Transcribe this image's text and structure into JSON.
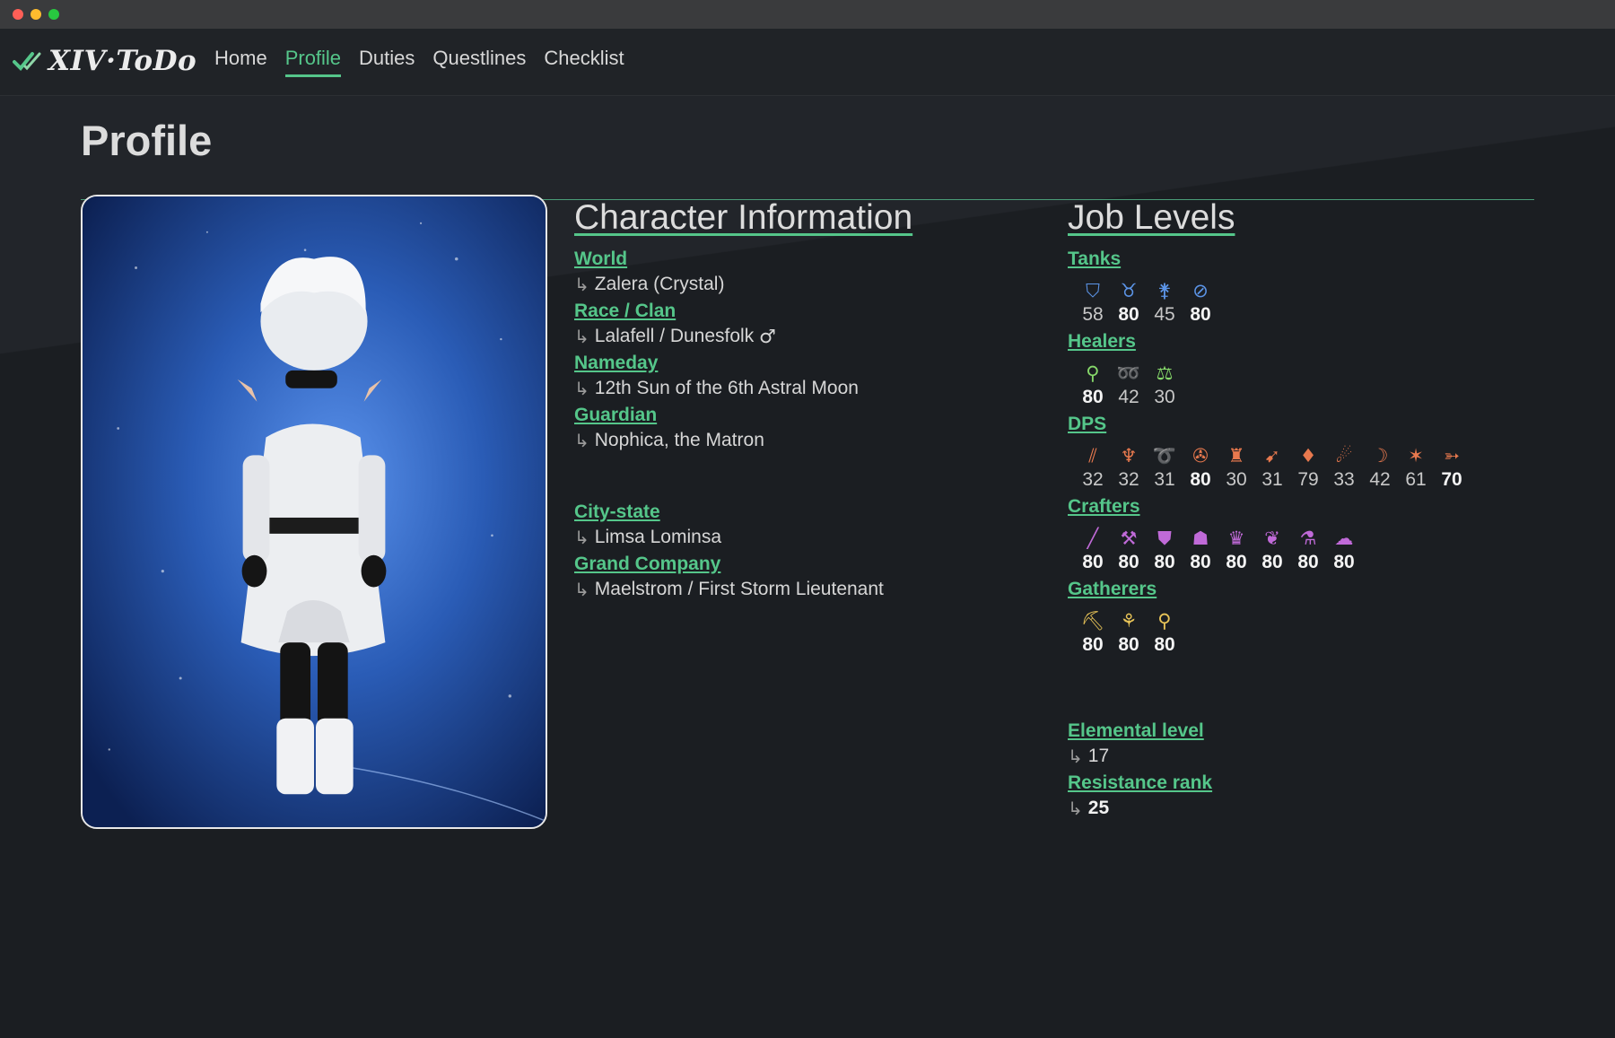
{
  "window": {
    "title": "XIV ToDo"
  },
  "nav": {
    "logo_text": "XIV·ToDo",
    "links": [
      "Home",
      "Profile",
      "Duties",
      "Questlines",
      "Checklist"
    ],
    "active": "Profile"
  },
  "page": {
    "title": "Profile"
  },
  "character": {
    "section_title": "Character Information",
    "world_label": "World",
    "world": "Zalera (Crystal)",
    "race_label": "Race / Clan",
    "race": "Lalafell / Dunesfolk",
    "gender_symbol": "♂",
    "nameday_label": "Nameday",
    "nameday": "12th Sun of the 6th Astral Moon",
    "guardian_label": "Guardian",
    "guardian": "Nophica, the Matron",
    "city_label": "City-state",
    "city": "Limsa Lominsa",
    "gc_label": "Grand Company",
    "gc": "Maelstrom / First Storm Lieutenant"
  },
  "jobs": {
    "section_title": "Job Levels",
    "tanks": {
      "label": "Tanks",
      "icons": [
        "paladin-icon",
        "warrior-icon",
        "dark-knight-icon",
        "gunbreaker-icon"
      ],
      "glyphs": [
        "⛉",
        "♉",
        "⚵",
        "⊘"
      ],
      "levels": [
        "58",
        "80",
        "45",
        "80"
      ],
      "max": [
        false,
        true,
        false,
        true
      ]
    },
    "healers": {
      "label": "Healers",
      "icons": [
        "white-mage-icon",
        "scholar-icon",
        "astrologian-icon"
      ],
      "glyphs": [
        "⚲",
        "➿",
        "⚖"
      ],
      "levels": [
        "80",
        "42",
        "30"
      ],
      "max": [
        true,
        false,
        false
      ]
    },
    "dps": {
      "label": "DPS",
      "icons": [
        "monk-icon",
        "dragoon-icon",
        "ninja-icon",
        "samurai-icon",
        "reaper-icon",
        "bard-icon",
        "machinist-icon",
        "dancer-icon",
        "black-mage-icon",
        "summoner-icon",
        "red-mage-icon"
      ],
      "glyphs": [
        "⫽",
        "♆",
        "➰",
        "✇",
        "♜",
        "➹",
        "♦",
        "☄",
        "☽",
        "✶",
        "➳"
      ],
      "levels": [
        "32",
        "32",
        "31",
        "80",
        "30",
        "31",
        "79",
        "33",
        "42",
        "61",
        "70"
      ],
      "max": [
        false,
        false,
        false,
        true,
        false,
        false,
        false,
        false,
        false,
        false,
        true
      ]
    },
    "crafters": {
      "label": "Crafters",
      "icons": [
        "carpenter-icon",
        "blacksmith-icon",
        "armorer-icon",
        "goldsmith-icon",
        "leatherworker-icon",
        "weaver-icon",
        "alchemist-icon",
        "culinarian-icon"
      ],
      "glyphs": [
        "╱",
        "⚒",
        "⛊",
        "☗",
        "♛",
        "❦",
        "⚗",
        "☁"
      ],
      "levels": [
        "80",
        "80",
        "80",
        "80",
        "80",
        "80",
        "80",
        "80"
      ],
      "max": [
        true,
        true,
        true,
        true,
        true,
        true,
        true,
        true
      ]
    },
    "gatherers": {
      "label": "Gatherers",
      "icons": [
        "miner-icon",
        "botanist-icon",
        "fisher-icon"
      ],
      "glyphs": [
        "⛏",
        "⚘",
        "⚲"
      ],
      "levels": [
        "80",
        "80",
        "80"
      ],
      "max": [
        true,
        true,
        true
      ]
    },
    "elemental_label": "Elemental level",
    "elemental": "17",
    "resistance_label": "Resistance rank",
    "resistance": "25"
  },
  "colors": {
    "accent": "#55c68a",
    "tank": "#5c95e8",
    "healer": "#86d86a",
    "dps": "#e8794e",
    "crafter": "#c06ad8",
    "gatherer": "#e8c458"
  }
}
